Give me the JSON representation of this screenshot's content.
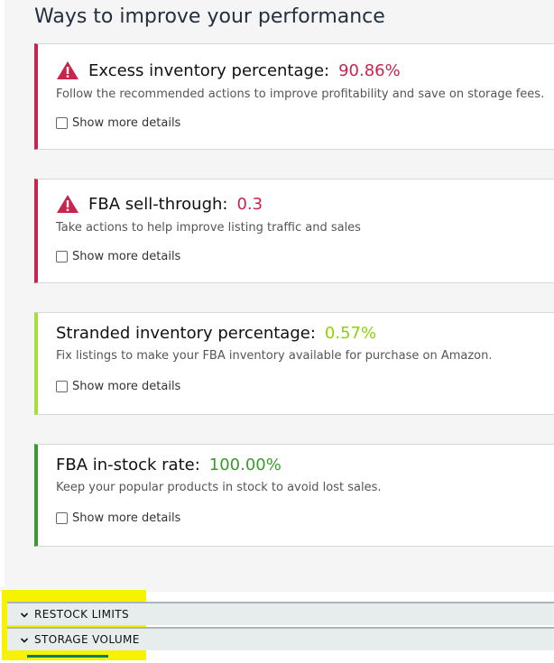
{
  "section": {
    "title": "Ways to improve your performance"
  },
  "cards": [
    {
      "label": "Excess inventory percentage:",
      "value": "90.86%",
      "value_color": "#c7254e",
      "status": "warning",
      "description": "Follow the recommended actions to improve profitability and save on storage fees.",
      "details_label": "Show more details"
    },
    {
      "label": "FBA sell-through:",
      "value": "0.3",
      "value_color": "#c7254e",
      "status": "warning",
      "description": "Take actions to help improve listing traffic and sales",
      "details_label": "Show more details"
    },
    {
      "label": "Stranded inventory percentage:",
      "value": "0.57%",
      "value_color": "#8fd400",
      "status": "fair",
      "description": "Fix listings to make your FBA inventory available for purchase on Amazon.",
      "details_label": "Show more details"
    },
    {
      "label": "FBA in-stock rate:",
      "value": "100.00%",
      "value_color": "#3a9b2d",
      "status": "good",
      "description": "Keep your popular products in stock to avoid lost sales.",
      "details_label": "Show more details"
    }
  ],
  "accordion": {
    "restock_limits": "RESTOCK LIMITS",
    "storage_volume": "STORAGE VOLUME"
  },
  "colors": {
    "warning_border": "#c7254e",
    "fair_border": "#a4e03a",
    "good_border": "#3a9b2d",
    "warning_icon": "#c7254e",
    "highlight": "#f7f200"
  },
  "icons": {
    "warning": "warning-triangle-icon",
    "chevron": "chevron-down-icon"
  }
}
